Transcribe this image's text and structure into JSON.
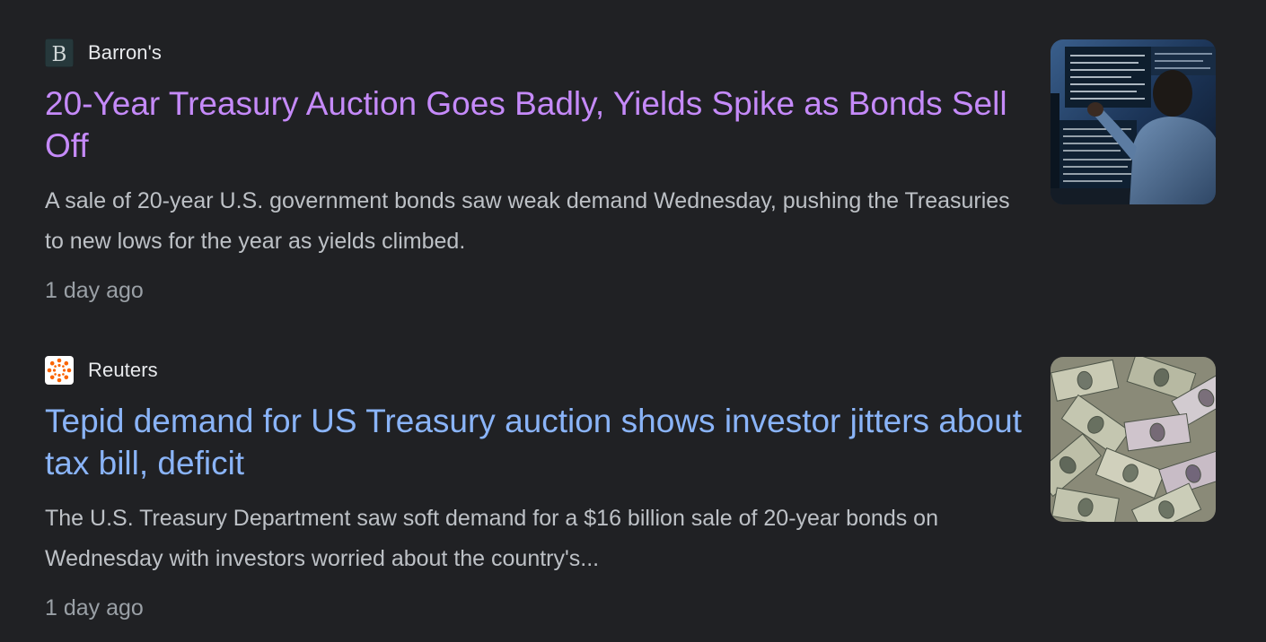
{
  "articles": [
    {
      "source": {
        "name": "Barron's",
        "favicon_icon": "barrons-logo-icon",
        "favicon_letter": "B"
      },
      "headline": "20-Year Treasury Auction Goes Badly, Yields Spike as Bonds Sell Off",
      "headline_color": "#c58af9",
      "snippet": "A sale of 20-year U.S. government bonds saw weak demand Wednesday, pushing the Treasuries to new lows for the year as yields climbed.",
      "timestamp": "1 day ago",
      "thumbnail": "trader-at-screens-photo"
    },
    {
      "source": {
        "name": "Reuters",
        "favicon_icon": "reuters-logo-icon"
      },
      "headline": "Tepid demand for US Treasury auction shows investor jitters about tax bill, deficit",
      "headline_color": "#8ab4f8",
      "snippet": "The U.S. Treasury Department saw soft demand for a $16 billion sale of 20-year bonds on Wednesday with investors worried about the country's...",
      "timestamp": "1 day ago",
      "thumbnail": "dollar-bills-photo"
    }
  ],
  "colors": {
    "background": "#202124",
    "source_text": "#e8eaed",
    "snippet_text": "#bdc1c6",
    "timestamp_text": "#9aa0a6",
    "visited_link": "#c58af9",
    "link": "#8ab4f8"
  }
}
